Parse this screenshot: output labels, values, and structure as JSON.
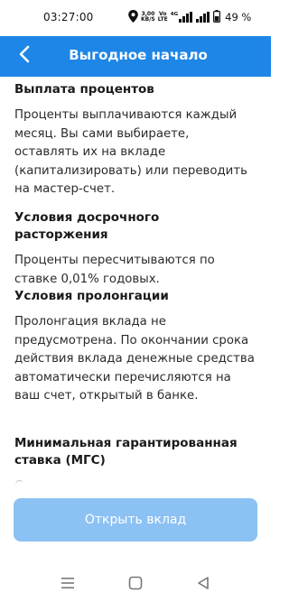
{
  "status_bar": {
    "time": "03:27:00",
    "speed_value": "3,00",
    "speed_unit": "KB/S",
    "volte_top": "Vo",
    "volte_bottom": "LTE",
    "signal_label": "4G",
    "battery": "49 %"
  },
  "header": {
    "title": "Выгодное начало"
  },
  "sections": [
    {
      "heading": "Выплата процентов",
      "body": "Проценты выплачиваются каждый месяц. Вы сами выбираете, оставлять их на вкладе (капитализировать) или переводить на мастер-счет."
    },
    {
      "heading": "Условия досрочного расторжения",
      "body": "Проценты пересчитываются по ставке 0,01% годовых."
    },
    {
      "heading": "Условия пролонгации",
      "body": "Пролонгация вклада не предусмотрена. По окончании срока действия вклада денежные средства автоматически перечисляются на ваш счет, открытый в банке."
    },
    {
      "heading": "Минимальная гарантированная ставка (МГС)",
      "body": "С"
    }
  ],
  "button": {
    "label": "Открыть вклад"
  },
  "colors": {
    "header_bg": "#1e86e6",
    "button_bg": "#8cc1f3"
  },
  "icons": {
    "back": "chevron-left-icon",
    "nav_menu": "menu-icon",
    "nav_home": "square-icon",
    "nav_back": "triangle-back-icon"
  }
}
